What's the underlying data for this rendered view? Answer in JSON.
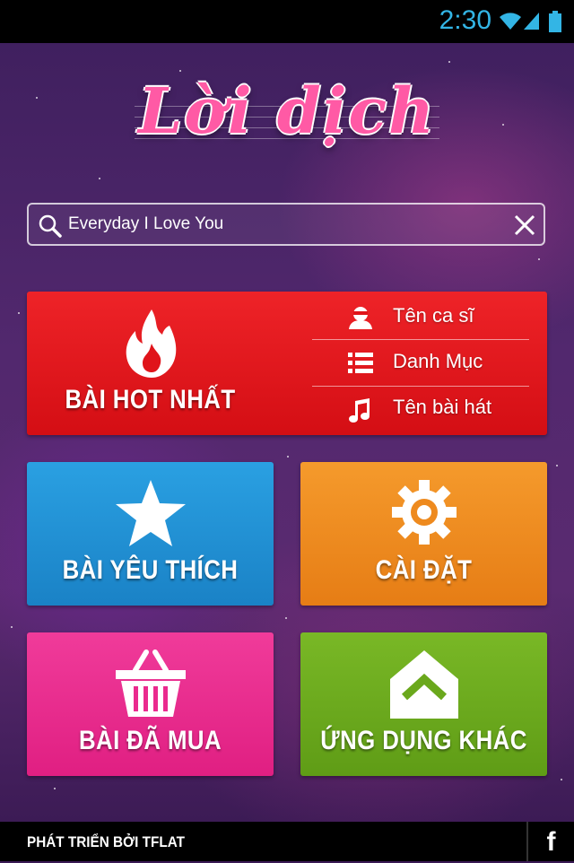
{
  "status_bar": {
    "time": "2:30"
  },
  "app": {
    "logo_text": "Lời dịch"
  },
  "search": {
    "value": "Everyday I Love You"
  },
  "hot_tile": {
    "label": "BÀI HOT NHẤT",
    "menu": [
      {
        "label": "Tên ca sĩ",
        "icon": "singer-icon"
      },
      {
        "label": "Danh Mục",
        "icon": "list-icon"
      },
      {
        "label": "Tên bài hát",
        "icon": "music-note-icon"
      }
    ]
  },
  "tiles": {
    "favorites": "BÀI YÊU THÍCH",
    "settings": "CÀI ĐẶT",
    "purchased": "BÀI ĐÃ MUA",
    "other_apps": "ỨNG DỤNG KHÁC"
  },
  "footer": {
    "credit": "PHÁT TRIỂN BỞI TFLAT",
    "facebook": "f"
  },
  "colors": {
    "hot": "#e0141a",
    "favorites": "#1f8fd2",
    "settings": "#ee8a1e",
    "purchased": "#ea2a8e",
    "other_apps": "#6aa81c",
    "clock": "#33b5e5"
  }
}
